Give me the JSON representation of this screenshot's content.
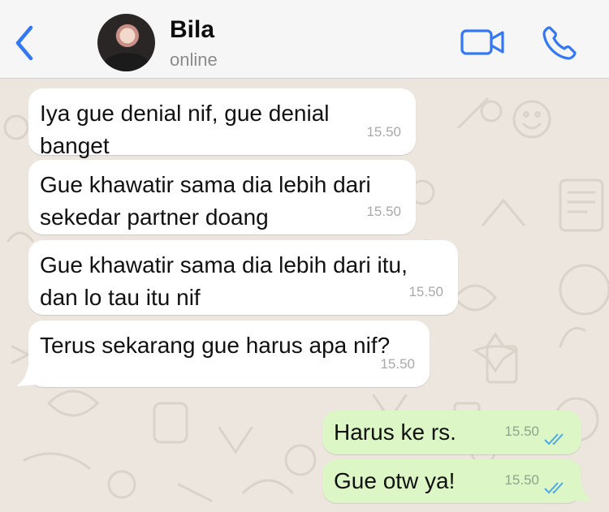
{
  "contact": {
    "name": "Bila",
    "status": "online"
  },
  "colors": {
    "accent": "#3478F6",
    "incoming_bubble": "#FFFFFF",
    "outgoing_bubble": "#DCF7C5",
    "read_ticks": "#4FA8E8"
  },
  "icons": [
    "back-chevron-icon",
    "video-call-icon",
    "phone-call-icon",
    "double-check-icon"
  ],
  "messages": [
    {
      "direction": "incoming",
      "lines": [
        "Iya gue denial nif, gue denial banget"
      ],
      "time": "15.50"
    },
    {
      "direction": "incoming",
      "lines": [
        "Gue khawatir sama dia lebih dari",
        "sekedar partner doang"
      ],
      "time": "15.50"
    },
    {
      "direction": "incoming",
      "lines": [
        "Gue khawatir sama dia lebih dari itu,",
        "dan lo tau itu nif"
      ],
      "time": "15.50"
    },
    {
      "direction": "incoming",
      "lines": [
        "Terus sekarang gue harus apa nif?"
      ],
      "time": "15.50"
    },
    {
      "direction": "outgoing",
      "lines": [
        "Harus ke rs."
      ],
      "time": "15.50",
      "read": true
    },
    {
      "direction": "outgoing",
      "lines": [
        "Gue otw ya!"
      ],
      "time": "15.50",
      "read": true
    }
  ]
}
